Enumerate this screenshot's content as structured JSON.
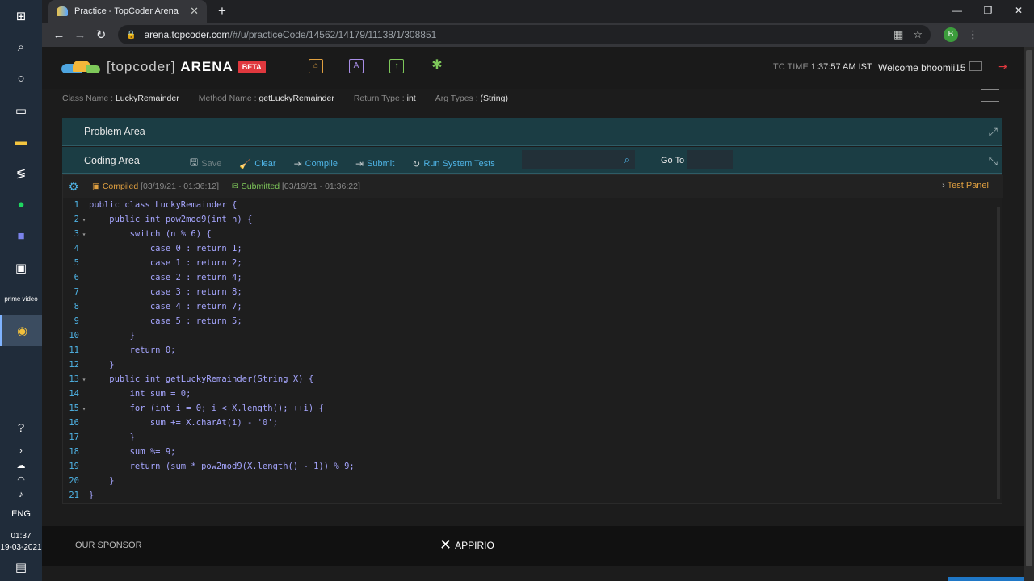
{
  "browser": {
    "tab_title": "Practice - TopCoder Arena",
    "url_host": "arena.topcoder.com",
    "url_path": "/#/u/practiceCode/14562/14179/11138/1/308851",
    "profile_initial": "B"
  },
  "taskbar": {
    "lang": "ENG",
    "time": "01:37",
    "date": "19-03-2021",
    "prime_label": "prime video"
  },
  "header": {
    "logo_text_left": "[topcoder]",
    "logo_text_right": "ARENA",
    "beta": "BETA",
    "tc_time_label": "TC TIME",
    "tc_time_value": "1:37:57 AM IST",
    "welcome": "Welcome bhoomii15"
  },
  "meta": {
    "class_label": "Class Name :",
    "class_value": "LuckyRemainder",
    "method_label": "Method Name :",
    "method_value": "getLuckyRemainder",
    "return_label": "Return Type :",
    "return_value": "int",
    "args_label": "Arg Types :",
    "args_value": "(String)"
  },
  "problem_area": {
    "title": "Problem Area"
  },
  "coding_area": {
    "title": "Coding Area",
    "save": "Save",
    "clear": "Clear",
    "compile": "Compile",
    "submit": "Submit",
    "run_tests": "Run System Tests",
    "goto": "Go To"
  },
  "status": {
    "compiled": "Compiled",
    "compiled_date": "[03/19/21 - 01:36:12]",
    "submitted": "Submitted",
    "submitted_date": "[03/19/21 - 01:36:22]",
    "test_panel": "Test Panel"
  },
  "code_lines": [
    "public class LuckyRemainder {",
    "    public int pow2mod9(int n) {",
    "        switch (n % 6) {",
    "            case 0 : return 1;",
    "            case 1 : return 2;",
    "            case 2 : return 4;",
    "            case 3 : return 8;",
    "            case 4 : return 7;",
    "            case 5 : return 5;",
    "        }",
    "        return 0;",
    "    }",
    "    public int getLuckyRemainder(String X) {",
    "        int sum = 0;",
    "        for (int i = 0; i < X.length(); ++i) {",
    "            sum += X.charAt(i) - '0';",
    "        }",
    "        sum %= 9;",
    "        return (sum * pow2mod9(X.length() - 1)) % 9;",
    "    }",
    "}"
  ],
  "fold_lines": [
    2,
    3,
    13,
    15
  ],
  "footer": {
    "sponsor": "OUR SPONSOR",
    "appirio": "APPIRIO"
  }
}
